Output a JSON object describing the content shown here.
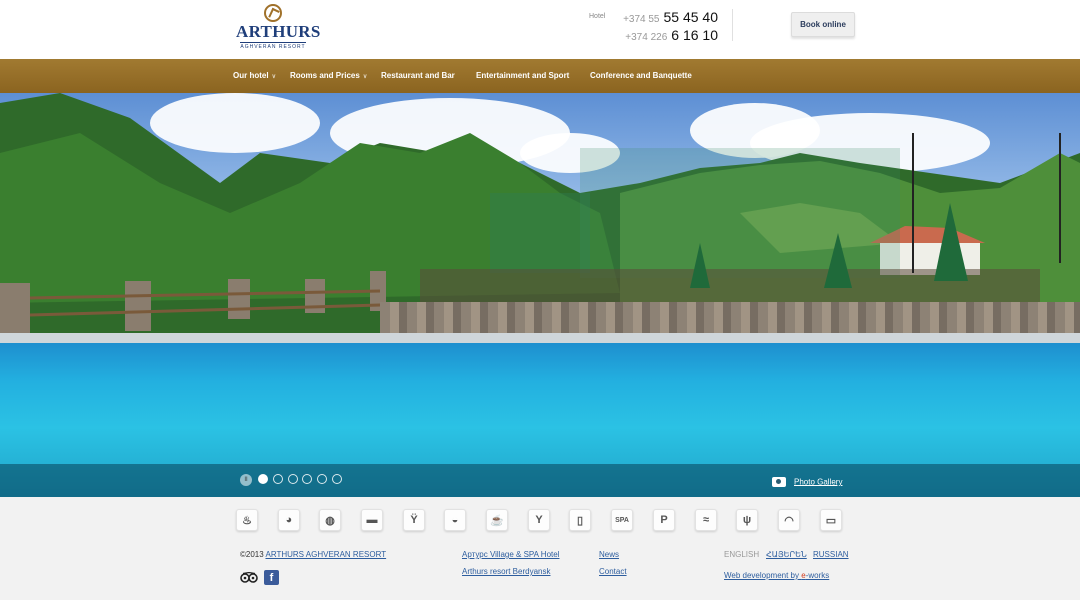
{
  "brand": {
    "name": "ARTHURS",
    "tagline": "AGHVERAN RESORT"
  },
  "contact": {
    "label": "Hotel",
    "phones": [
      {
        "code": "+374 55",
        "number": "55 45 40"
      },
      {
        "code": "+374 226",
        "number": "6 16 10"
      }
    ]
  },
  "header": {
    "book_label": "Book online"
  },
  "nav": {
    "items": [
      {
        "label": "Our hotel",
        "has_dropdown": true
      },
      {
        "label": "Rooms and Prices",
        "has_dropdown": true
      },
      {
        "label": "Restaurant and Bar",
        "has_dropdown": false
      },
      {
        "label": "Entertainment and Sport",
        "has_dropdown": false
      },
      {
        "label": "Conference and Banquette",
        "has_dropdown": false
      }
    ]
  },
  "slider": {
    "pause_icon": "pause-icon",
    "slide_count": 6,
    "active_slide": 1,
    "gallery_icon": "camera-icon",
    "gallery_label": "Photo Gallery"
  },
  "amenities": [
    {
      "icon": "spa-bath-icon",
      "glyph": "♨"
    },
    {
      "icon": "tennis-ball-icon",
      "glyph": "◕"
    },
    {
      "icon": "basketball-icon",
      "glyph": "◍"
    },
    {
      "icon": "bed-icon",
      "glyph": "▬"
    },
    {
      "icon": "wine-bar-icon",
      "glyph": "Ÿ"
    },
    {
      "icon": "food-cloche-icon",
      "glyph": "◒"
    },
    {
      "icon": "coffee-icon",
      "glyph": "☕"
    },
    {
      "icon": "cocktail-icon",
      "glyph": "Y"
    },
    {
      "icon": "fridge-icon",
      "glyph": "▯"
    },
    {
      "icon": "spa-label-icon",
      "glyph": "SPA"
    },
    {
      "icon": "parking-icon",
      "glyph": "P"
    },
    {
      "icon": "swimming-icon",
      "glyph": "≈"
    },
    {
      "icon": "restaurant-icon",
      "glyph": "ψ"
    },
    {
      "icon": "wifi-icon",
      "glyph": "◠"
    },
    {
      "icon": "tv-icon",
      "glyph": "▭"
    }
  ],
  "footer": {
    "copyright_prefix": "©2013 ",
    "copyright_link": "ARTHURS AGHVERAN RESORT",
    "partner_links": [
      "Артурс Village & SPA Hotel",
      "Arthurs resort Berdyansk"
    ],
    "site_links": [
      "News",
      "Contact"
    ],
    "languages": [
      {
        "label": "ENGLISH",
        "current": true
      },
      {
        "label": "ՀԱՅԵՐԵՆ",
        "current": false
      },
      {
        "label": "RUSSIAN",
        "current": false
      }
    ],
    "dev_prefix": "Web development by ",
    "dev_brand_e": "e",
    "dev_brand_rest": "-works",
    "social": {
      "tripadvisor_icon": "tripadvisor-icon",
      "facebook_icon": "facebook-icon",
      "facebook_glyph": "f"
    }
  },
  "colors": {
    "nav_gold": "#9a7229",
    "brand_blue": "#1f3e7a",
    "link_blue": "#2d5d9e",
    "pool_blue": "#23b0e0"
  }
}
